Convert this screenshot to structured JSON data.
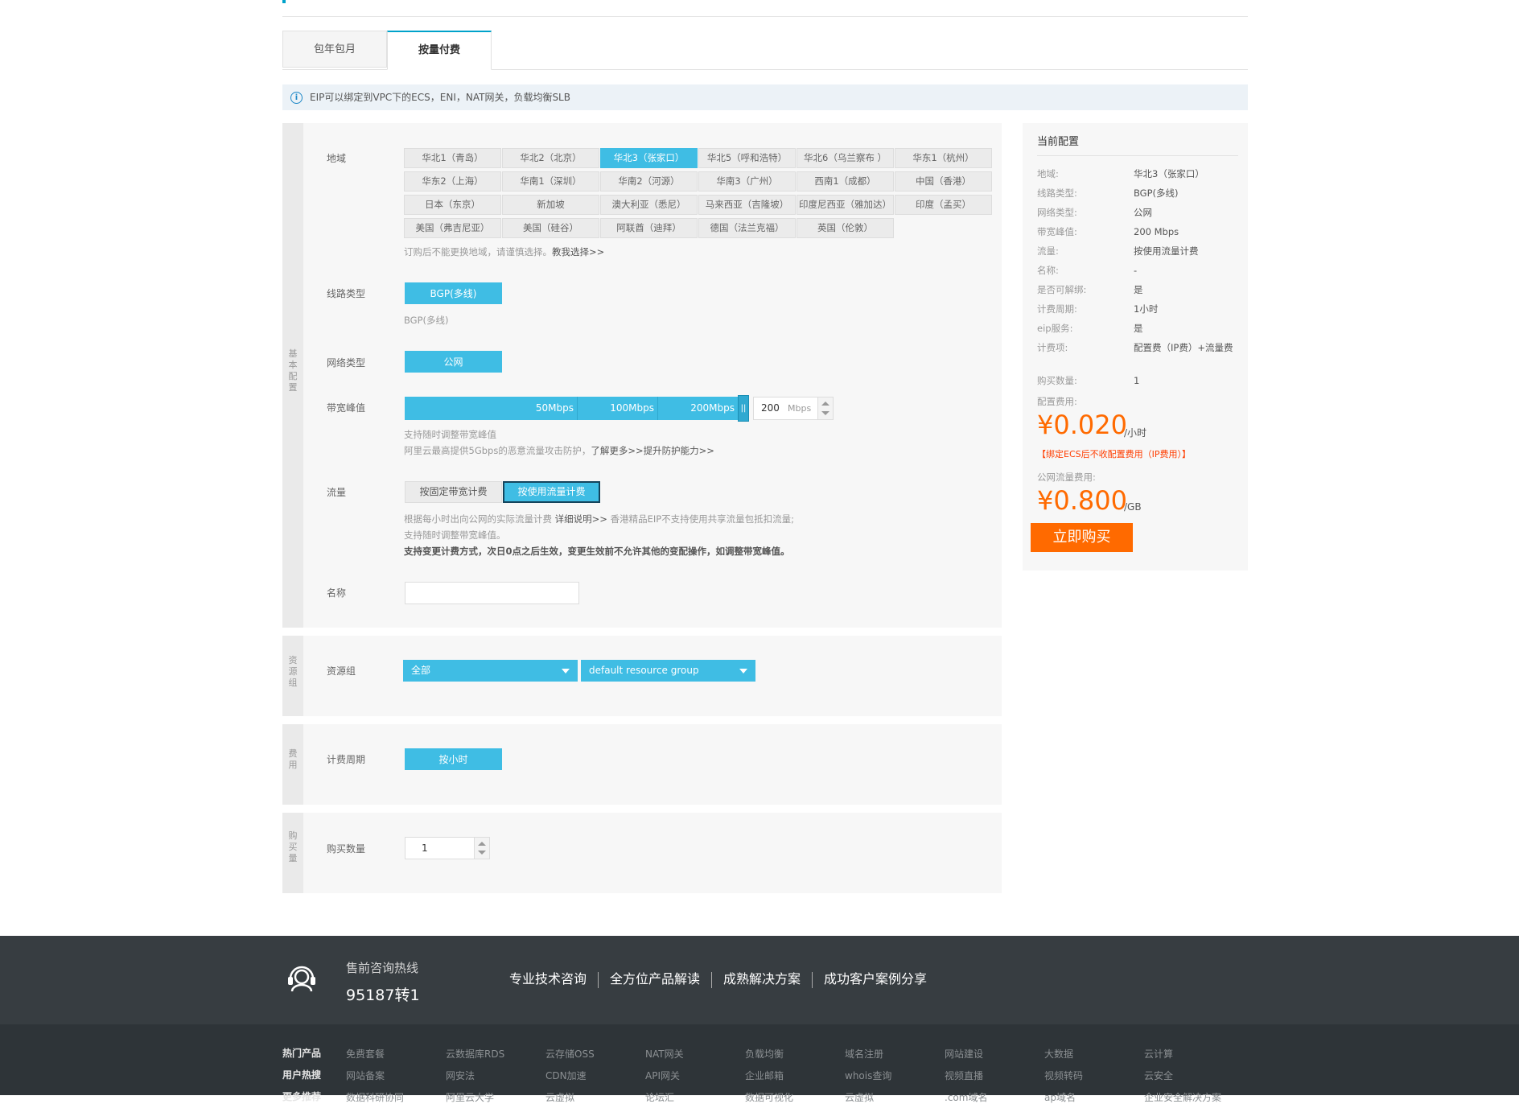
{
  "tabs": {
    "items": [
      "包年包月",
      "按量付费"
    ],
    "active": 1
  },
  "notice": {
    "text": "EIP可以绑定到VPC下的ECS，ENI，NAT网关，负载均衡SLB"
  },
  "basic": {
    "side_label": "基本配置",
    "region": {
      "label": "地域",
      "options": [
        "华北1（青岛）",
        "华北2（北京）",
        "华北3（张家口）",
        "华北5（呼和浩特）",
        "华北6（乌兰察布 ）",
        "华东1（杭州）",
        "华东2（上海）",
        "华南1（深圳）",
        "华南2（河源）",
        "华南3（广州）",
        "西南1（成都）",
        "中国（香港）",
        "日本（东京）",
        "新加坡",
        "澳大利亚（悉尼）",
        "马来西亚（吉隆坡）",
        "印度尼西亚（雅加达）",
        "印度（孟买）",
        "美国（弗吉尼亚）",
        "美国（硅谷）",
        "阿联酋（迪拜）",
        "德国（法兰克福）",
        "英国（伦敦）"
      ],
      "selected": "华北3（张家口）",
      "hint": "订购后不能更换地域，请谨慎选择。",
      "hint_link": "教我选择>>"
    },
    "line": {
      "label": "线路类型",
      "option": "BGP(多线)",
      "hint": "BGP(多线)"
    },
    "network": {
      "label": "网络类型",
      "option": "公网"
    },
    "bandwidth": {
      "label": "带宽峰值",
      "ticks": [
        "50Mbps",
        "100Mbps",
        "200Mbps"
      ],
      "value": "200",
      "unit": "Mbps",
      "hint1": "支持随时调整带宽峰值",
      "hint2_a": "阿里云最高提供5Gbps的恶意流量攻击防护，",
      "hint2_b": "了解更多>>提升防护能力>>"
    },
    "traffic": {
      "label": "流量",
      "options": [
        "按固定带宽计费",
        "按使用流量计费"
      ],
      "selected": "按使用流量计费",
      "hint1_a": "根据每小时出向公网的实际流量计费 ",
      "hint1_b": "详细说明>>",
      "hint1_c": " 香港精品EIP不支持使用共享流量包抵扣流量;",
      "hint2": "支持随时调整带宽峰值。",
      "hint3": "支持变更计费方式，次日0点之后生效，变更生效前不允许其他的变配操作，如调整带宽峰值。"
    },
    "name": {
      "label": "名称",
      "value": ""
    }
  },
  "resource": {
    "side_label": "资源组",
    "label": "资源组",
    "select1": "全部",
    "select2": "default resource group"
  },
  "fee": {
    "side_label": "费用",
    "label": "计费周期",
    "option": "按小时"
  },
  "quantity": {
    "side_label": "购买量",
    "label": "购买数量",
    "value": "1"
  },
  "summary": {
    "title": "当前配置",
    "rows": [
      {
        "k": "地域:",
        "v": "华北3（张家口）"
      },
      {
        "k": "线路类型:",
        "v": "BGP(多线)"
      },
      {
        "k": "网络类型:",
        "v": "公网"
      },
      {
        "k": "带宽峰值:",
        "v": "200 Mbps"
      },
      {
        "k": "流量:",
        "v": "按使用流量计费"
      },
      {
        "k": "名称:",
        "v": "-"
      },
      {
        "k": "是否可解绑:",
        "v": "是"
      },
      {
        "k": "计费周期:",
        "v": "1小时"
      },
      {
        "k": "eip服务:",
        "v": "是"
      },
      {
        "k": "计费项:",
        "v": "配置费（IP费）+流量费"
      },
      {
        "k": "购买数量:",
        "v": "1"
      }
    ],
    "config_fee_label": "配置费用:",
    "config_price": "¥0.020",
    "config_unit": "/小时",
    "warn": "【绑定ECS后不收配置费用（IP费用）】",
    "traffic_fee_label": "公网流量费用:",
    "traffic_price": "¥0.800",
    "traffic_unit": "/GB",
    "buy": "立即购买",
    "accent": "#ff6a00"
  },
  "footer": {
    "hotline_title": "售前咨询热线",
    "hotline_number": "95187转1",
    "links": [
      "专业技术咨询",
      "全方位产品解读",
      "成熟解决方案",
      "成功客户案例分享"
    ],
    "row_heads": [
      "热门产品",
      "用户热搜",
      "更多推荐"
    ],
    "row1": [
      "免费套餐",
      "云数据库RDS",
      "云存储OSS",
      "NAT网关",
      "负载均衡",
      "域名注册",
      "网站建设",
      "大数据",
      "云计算"
    ],
    "row2": [
      "网站备案",
      "网安法",
      "CDN加速",
      "API网关",
      "企业邮箱",
      "whois查询",
      "视频直播",
      "视频转码",
      "云安全"
    ],
    "row3": [
      "数据科研协同",
      "阿里云大学",
      "云虚拟",
      "论坛汇",
      "数据可视化",
      "云虚拟",
      ".com域名",
      "ap域名",
      "企业安全解决方案"
    ]
  },
  "colors": {
    "primary": "#3fbde4",
    "footer": "#373d41"
  }
}
